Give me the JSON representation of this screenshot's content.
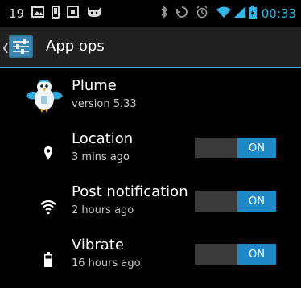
{
  "status_bar": {
    "notification_count": "19",
    "time": "00:33",
    "left_icons": [
      "notification-count-icon",
      "gallery-icon",
      "phone-icon",
      "calendar-icon",
      "cat-icon"
    ],
    "right_icons": [
      "bluetooth-icon",
      "sync-icon",
      "alarm-icon",
      "wifi-icon",
      "signal-icon",
      "battery-icon"
    ]
  },
  "action_bar": {
    "title": "App ops",
    "app_icon": "settings-sliders-icon",
    "accent_color": "#33b5e5"
  },
  "app": {
    "name": "Plume",
    "version": "version 5.33",
    "icon": "plume-bird-icon"
  },
  "ops": [
    {
      "title": "Location",
      "subtitle": "3 mins ago",
      "icon": "location-pin-icon",
      "toggle_label": "ON",
      "enabled": true
    },
    {
      "title": "Post notification",
      "subtitle": "2 hours ago",
      "icon": "wifi-icon",
      "toggle_label": "ON",
      "enabled": true
    },
    {
      "title": "Vibrate",
      "subtitle": "16 hours ago",
      "icon": "battery-icon",
      "toggle_label": "ON",
      "enabled": true
    }
  ],
  "colors": {
    "background": "#000000",
    "action_bar": "#212121",
    "toggle_on": "#1f89c7",
    "toggle_track": "#3a3a3a",
    "time_text": "#33b5e5"
  }
}
